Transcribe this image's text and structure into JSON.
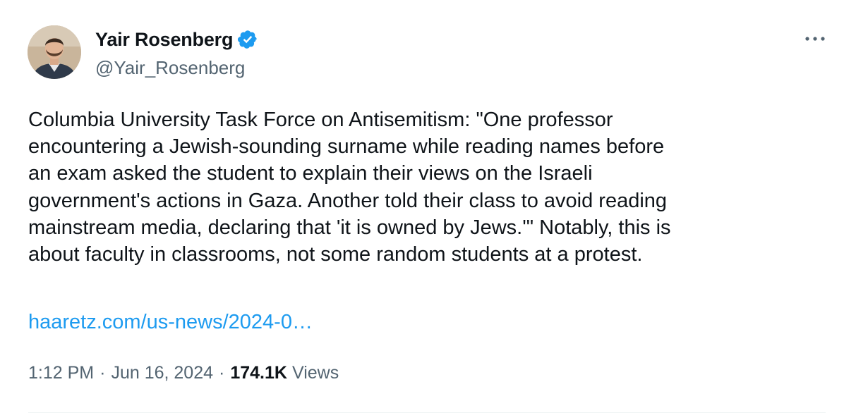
{
  "tweet": {
    "author": {
      "display_name": "Yair Rosenberg",
      "handle": "@Yair_Rosenberg",
      "verified": true,
      "avatar_icon": "profile-photo"
    },
    "more_icon": "more-options-icon",
    "text": "Columbia University Task Force on Antisemitism: \"One professor\nencountering a Jewish-sounding surname while reading names before\nan exam asked the student to explain their views on the Israeli\ngovernment's actions in Gaza. Another told their class to avoid reading\nmainstream media, declaring that 'it is owned by Jews.'\" Notably, this is\nabout faculty in classrooms, not some random students at a protest.",
    "link_text": "haaretz.com/us-news/2024-0…",
    "time": "1:12 PM",
    "separator": "·",
    "date": "Jun 16, 2024",
    "views_count": "174.1K",
    "views_label": "Views"
  },
  "colors": {
    "text_primary": "#0f1419",
    "text_secondary": "#536471",
    "link": "#1d9bf0",
    "verified_badge": "#1d9bf0"
  }
}
